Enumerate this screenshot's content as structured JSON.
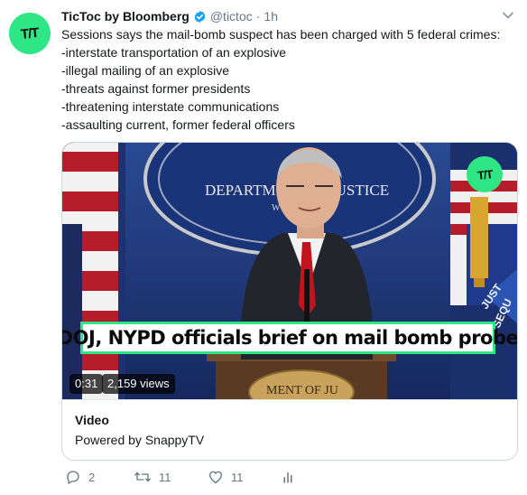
{
  "tweet": {
    "avatar_text": "T/T",
    "author_name": "TicToc by Bloomberg",
    "handle": "@tictoc",
    "separator": "·",
    "time": "1h",
    "text_lines": [
      "Sessions says the mail-bomb suspect has been charged with 5 federal crimes:",
      "-interstate transportation of an explosive",
      "-illegal mailing of an explosive",
      "-threats against former presidents",
      "-threatening interstate communications",
      "-assaulting current, former federal officers"
    ]
  },
  "media": {
    "backdrop_text_left": "DEPARTM",
    "backdrop_text_right": "JUSTICE",
    "backdrop_text_small": "W",
    "seal_bottom_text": "MENT OF JU",
    "flag_banner_text_1": "JUST",
    "flag_banner_text_2": "SEQU",
    "logo_text": "T/T",
    "lower_third": "DOJ, NYPD officials brief on mail bomb probe",
    "duration": "0:31",
    "views": "2,159 views"
  },
  "card": {
    "title": "Video",
    "subtitle": "Powered by SnappyTV"
  },
  "actions": {
    "replies": "2",
    "retweets": "11",
    "likes": "11"
  },
  "colors": {
    "brand_green": "#2ee683",
    "verified_blue": "#1da1f2",
    "muted_text": "#657786"
  }
}
